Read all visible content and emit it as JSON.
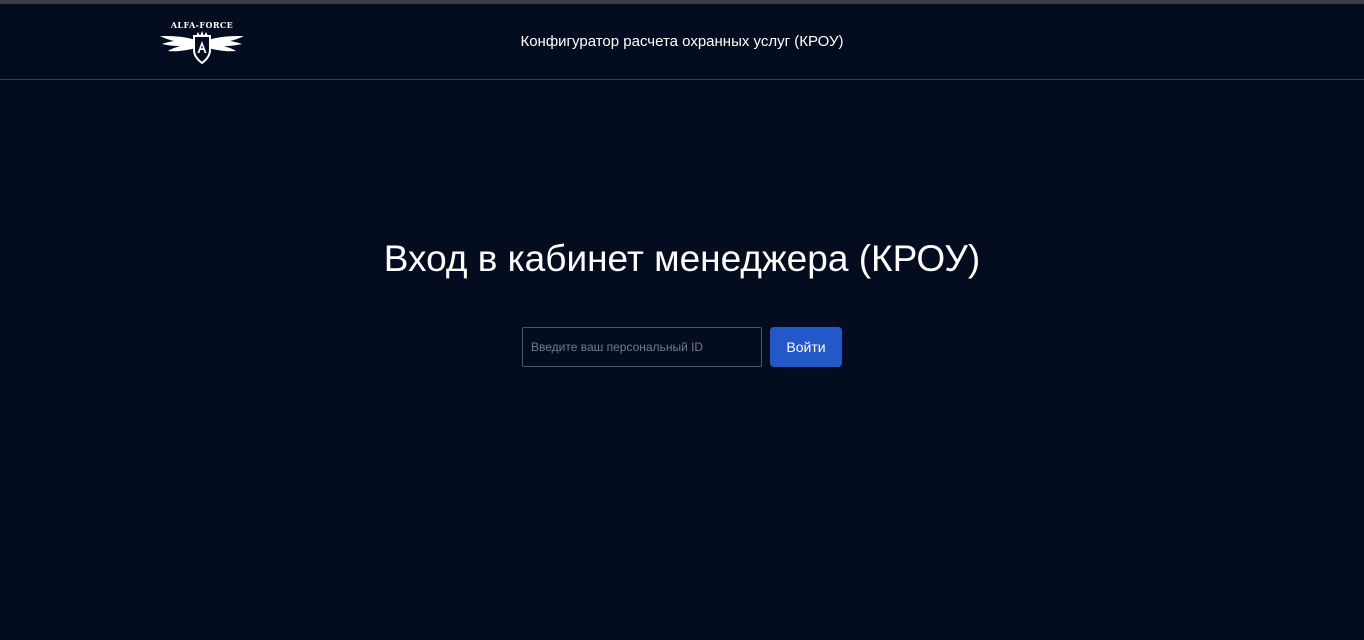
{
  "header": {
    "logo_text": "ALFA-FORCE",
    "logo_icon": "winged-shield-logo",
    "title": "Конфигуратор расчета охранных услуг (КРОУ)"
  },
  "main": {
    "heading": "Вход в кабинет менеджера (КРОУ)",
    "login": {
      "id_placeholder": "Введите ваш персональный ID",
      "id_value": "",
      "submit_label": "Войти"
    }
  },
  "colors": {
    "background": "#040d1f",
    "accent": "#2458c8",
    "text": "#ffffff",
    "border": "#4a5368"
  }
}
